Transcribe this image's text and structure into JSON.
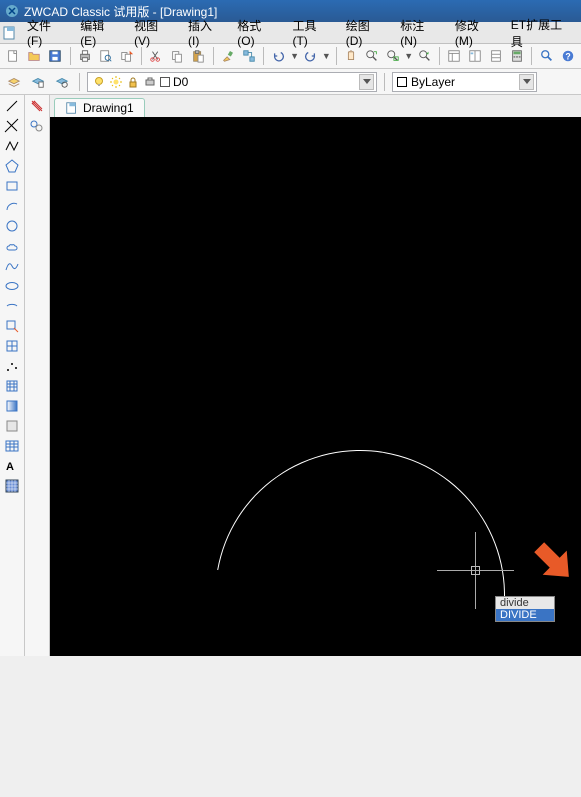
{
  "title": "ZWCAD Classic 试用版 - [Drawing1]",
  "menu": [
    "文件(F)",
    "编辑(E)",
    "视图(V)",
    "插入(I)",
    "格式(O)",
    "工具(T)",
    "绘图(D)",
    "标注(N)",
    "修改(M)",
    "ET扩展工具"
  ],
  "toolbar1": {
    "d0_label": "D0"
  },
  "layerbar": {
    "layer_selected": "",
    "bylayer_label": "ByLayer"
  },
  "tab": {
    "label": "Drawing1"
  },
  "command": {
    "typed": "divide",
    "suggestion": "DIVIDE"
  },
  "colors": {
    "titlebar": "#2a5a94",
    "accent": "#3a74c4",
    "canvas": "#000000",
    "arrow": "#e85a28"
  }
}
